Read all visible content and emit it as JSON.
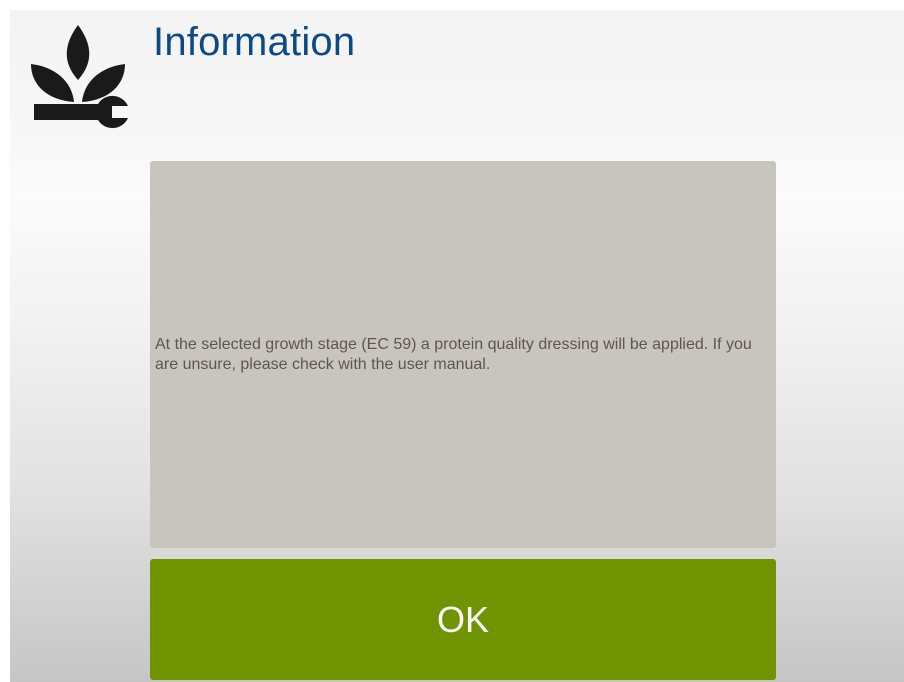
{
  "dialog": {
    "title": "Information",
    "message": "At the selected growth stage (EC 59) a protein quality dressing will be applied. If you are unsure, please check with the user manual.",
    "ok_label": "OK"
  },
  "icons": {
    "logo": "plant-wrench-icon"
  },
  "colors": {
    "title": "#0d4a84",
    "message_box": "#c8c4be",
    "message_text": "#5b5650",
    "ok_button": "#6f9400",
    "ok_text": "#ffffff",
    "logo": "#1a1a1a"
  }
}
